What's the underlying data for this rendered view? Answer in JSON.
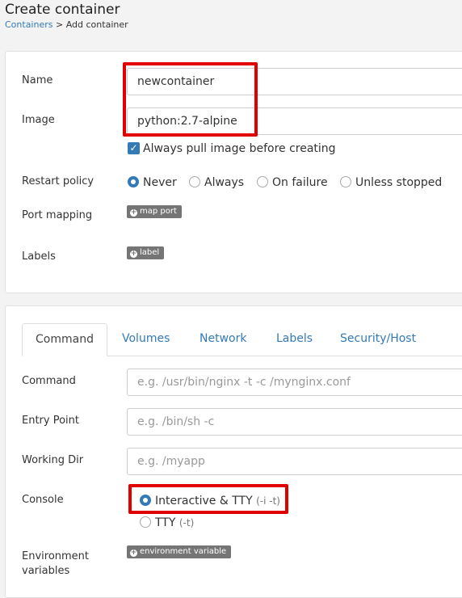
{
  "page": {
    "title": "Create container",
    "breadcrumb": {
      "link": "Containers",
      "separator": ">",
      "current": "Add container"
    }
  },
  "basic": {
    "name_label": "Name",
    "name_value": "newcontainer",
    "image_label": "Image",
    "image_value": "python:2.7-alpine",
    "always_pull_label": "Always pull image before creating",
    "always_pull_checked": true,
    "restart_label": "Restart policy",
    "restart_options": [
      "Never",
      "Always",
      "On failure",
      "Unless stopped"
    ],
    "restart_selected": "Never",
    "port_label": "Port mapping",
    "port_button": "map port",
    "labels_label": "Labels",
    "labels_button": "label"
  },
  "advanced": {
    "tabs": [
      "Command",
      "Volumes",
      "Network",
      "Labels",
      "Security/Host"
    ],
    "active_tab": "Command",
    "command_label": "Command",
    "command_placeholder": "e.g. /usr/bin/nginx -t -c /mynginx.conf",
    "entry_label": "Entry Point",
    "entry_placeholder": "e.g. /bin/sh -c",
    "workdir_label": "Working Dir",
    "workdir_placeholder": "e.g. /myapp",
    "console_label": "Console",
    "console_opt1": "Interactive & TTY",
    "console_opt1_hint": "(-i -t)",
    "console_opt2": "TTY",
    "console_opt2_hint": "(-t)",
    "console_selected": "Interactive & TTY",
    "env_label_line1": "Environment",
    "env_label_line2": "variables",
    "env_button": "environment variable"
  },
  "colors": {
    "link": "#337ab7",
    "highlight": "#e00000",
    "button_gray": "#757575"
  }
}
